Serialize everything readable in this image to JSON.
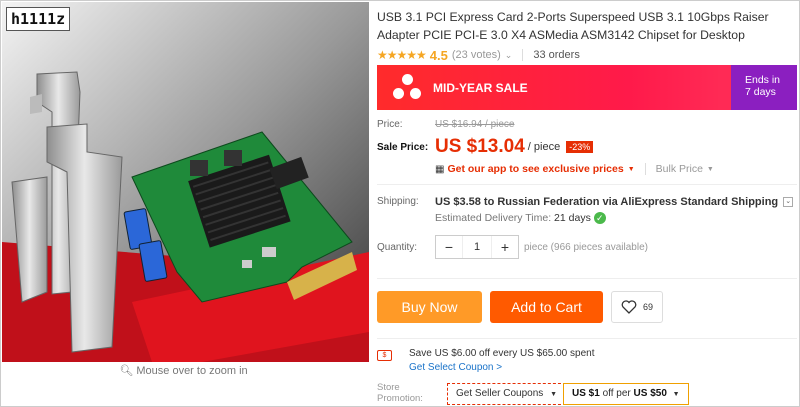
{
  "store_tag": "h1111z",
  "gallery": {
    "zoom_hint": "Mouse over to zoom in"
  },
  "product": {
    "title": "USB 3.1 PCI Express Card 2-Ports Superspeed USB 3.1 10Gbps Raiser Adapter PCIE PCI-E 3.0 X4 ASMedia ASM3142 Chipset for Desktop",
    "stars": "★★★★★",
    "rating": "4.5",
    "votes": "(23 votes)",
    "orders": "33 orders"
  },
  "sale_banner": {
    "label": "MID-YEAR SALE",
    "ends_label": "Ends in",
    "ends_value": "7 days",
    "colors": {
      "red": "#ff2b2b",
      "purple": "#8b1fc0"
    }
  },
  "price": {
    "price_label": "Price:",
    "original": "US $16.94 / piece",
    "sale_label": "Sale Price:",
    "sale_value": "US $13.04",
    "per_piece": "/ piece",
    "discount": "-23%",
    "app_promo": "Get our app to see exclusive prices",
    "bulk_price": "Bulk Price"
  },
  "shipping": {
    "label": "Shipping:",
    "details": "US $3.58 to Russian Federation via AliExpress Standard Shipping",
    "delivery_label": "Estimated Delivery Time:",
    "delivery_value": "21  days"
  },
  "quantity": {
    "label": "Quantity:",
    "minus": "−",
    "value": "1",
    "plus": "+",
    "available": "piece (966 pieces available)"
  },
  "actions": {
    "buy_now": "Buy Now",
    "add_to_cart": "Add to Cart",
    "wishlist_count": "69"
  },
  "coupon": {
    "text": "Save US $6.00 off every US $65.00 spent",
    "link": "Get Select Coupon >"
  },
  "store_promotion": {
    "label_line1": "Store",
    "label_line2": "Promotion:",
    "seller_coupons": "Get Seller Coupons",
    "promo_prefix": "US $1",
    "promo_mid": "off per",
    "promo_suffix": "US $50"
  },
  "colors": {
    "accent_orange": "#ff5a00",
    "buy_orange": "#ff9a27",
    "price_red": "#e62e04",
    "link_blue": "#1a73c9"
  }
}
